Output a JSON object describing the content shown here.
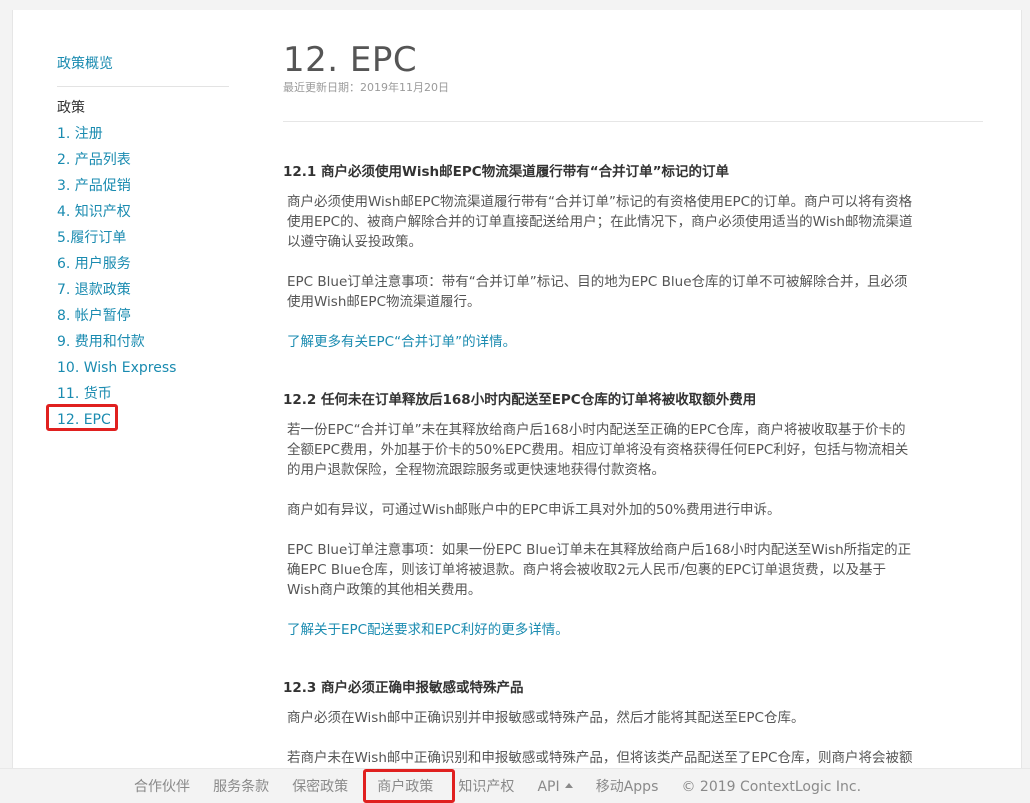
{
  "sidebar": {
    "overview": "政策概览",
    "heading": "政策",
    "items": [
      {
        "label": "1. 注册"
      },
      {
        "label": "2. 产品列表"
      },
      {
        "label": "3. 产品促销"
      },
      {
        "label": "4. 知识产权"
      },
      {
        "label": "5.履行订单"
      },
      {
        "label": "6. 用户服务"
      },
      {
        "label": "7. 退款政策"
      },
      {
        "label": "8. 帐户暂停"
      },
      {
        "label": "9. 费用和付款"
      },
      {
        "label": "10. Wish Express"
      },
      {
        "label": "11. 货币"
      },
      {
        "label": "12. EPC"
      }
    ]
  },
  "main": {
    "title": "12. EPC",
    "updated": "最近更新日期：2019年11月20日",
    "s1": {
      "title": "12.1 商户必须使用Wish邮EPC物流渠道履行带有“合并订单”标记的订单",
      "p1": [
        "商户必须使用Wish邮EPC物流渠道履行带有“合并订单”标记的有资格使用EPC的订单。商户可以将有资格",
        "使用EPC的、被商户解除合并的订单直接配送给用户；在此情况下，商户必须使用适当的Wish邮物流渠道",
        "以遵守确认妥投政策。"
      ],
      "p2": [
        "EPC Blue订单注意事项：带有“合并订单”标记、目的地为EPC Blue仓库的订单不可被解除合并，且必须",
        "使用Wish邮EPC物流渠道履行。"
      ],
      "link": "了解更多有关EPC“合并订单”的详情。"
    },
    "s2": {
      "title": "12.2 任何未在订单释放后168小时内配送至EPC仓库的订单将被收取额外费用",
      "p1": [
        "若一份EPC“合并订单”未在其释放给商户后168小时内配送至正确的EPC仓库，商户将被收取基于价卡的",
        "全额EPC费用，外加基于价卡的50%EPC费用。相应订单将没有资格获得任何EPC利好，包括与物流相关",
        "的用户退款保险，全程物流跟踪服务或更快速地获得付款资格。"
      ],
      "p2": [
        "商户如有异议，可通过Wish邮账户中的EPC申诉工具对外加的50%费用进行申诉。"
      ],
      "p3": [
        "EPC Blue订单注意事项：如果一份EPC Blue订单未在其释放给商户后168小时内配送至Wish所指定的正",
        "确EPC Blue仓库，则该订单将被退款。商户将会被收取2元人民币/包裹的EPC订单退货费，以及基于",
        "Wish商户政策的其他相关费用。"
      ],
      "link": "了解关于EPC配送要求和EPC利好的更多详情。"
    },
    "s3": {
      "title": "12.3 商户必须正确申报敏感或特殊产品",
      "p1": [
        "商户必须在Wish邮中正确识别并申报敏感或特殊产品，然后才能将其配送至EPC仓库。"
      ],
      "p2_partial": [
        "若商户未在Wish邮中正确识别和申报敏感或特殊产品，但将该类产品配送至了EPC仓库，则商户将会被额"
      ]
    }
  },
  "footer": {
    "links": [
      "合作伙伴",
      "服务条款",
      "保密政策",
      "商户政策",
      "知识产权",
      "API",
      "移动Apps"
    ],
    "copyright": "© 2019 ContextLogic Inc."
  },
  "colors": {
    "link": "#1a8bb0",
    "highlight": "#e0201f",
    "text": "#555555"
  }
}
